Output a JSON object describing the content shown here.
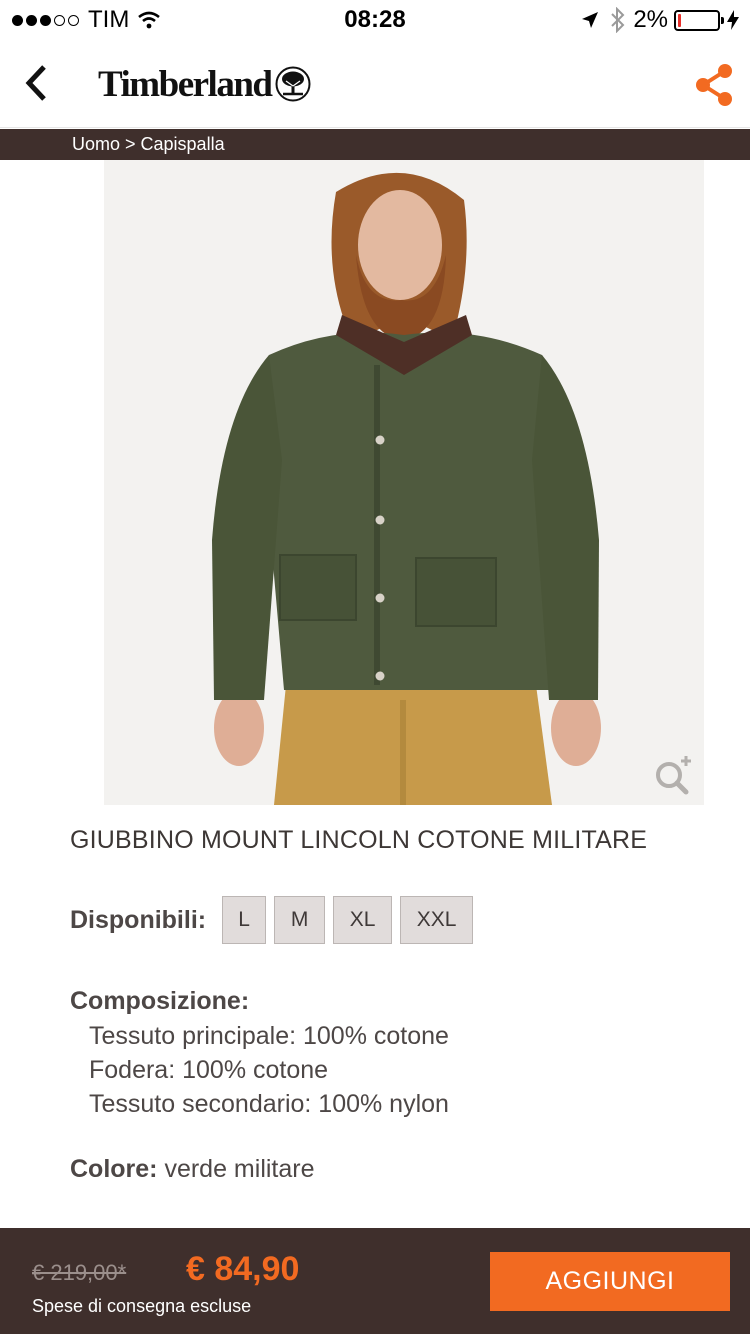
{
  "status_bar": {
    "carrier": "TIM",
    "time": "08:28",
    "battery_percent": "2%",
    "battery_level": 0.02,
    "signal_bars_filled": 3,
    "signal_bars_total": 5
  },
  "header": {
    "brand": "Timberland",
    "back_icon": "chevron-left-icon",
    "share_icon": "share-icon",
    "accent_color": "#f26a21"
  },
  "breadcrumb": {
    "text": "Uomo > Capispalla"
  },
  "product": {
    "image_alt": "jacket-photo",
    "zoom_icon": "zoom-in-icon",
    "title": "GIUBBINO MOUNT LINCOLN COTONE MILITARE",
    "sizes_label": "Disponibili:",
    "sizes": [
      "L",
      "M",
      "XL",
      "XXL"
    ],
    "composition_label": "Composizione:",
    "composition": [
      "Tessuto principale: 100% cotone",
      "Fodera: 100% cotone",
      "Tessuto secondario: 100% nylon"
    ],
    "color_label": "Colore:",
    "color_value": "verde militare"
  },
  "purchase_bar": {
    "old_price": "€ 219,00*",
    "new_price": "€ 84,90",
    "shipping_note": "Spese di consegna escluse",
    "add_button_label": "AGGIUNGI",
    "bar_color": "#3f2f2c"
  }
}
